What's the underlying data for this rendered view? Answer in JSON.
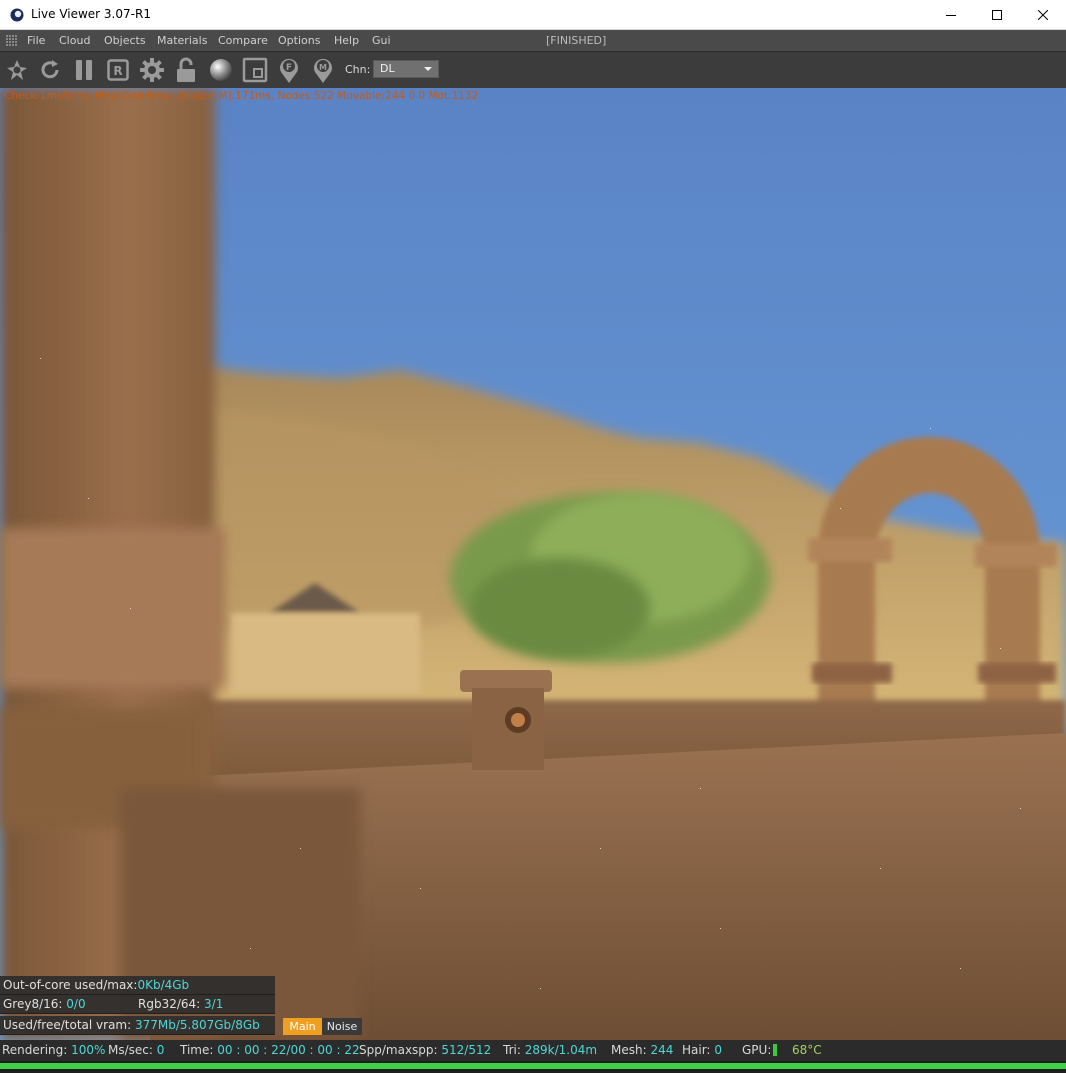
{
  "window": {
    "title": "Live Viewer 3.07-R1"
  },
  "menu": {
    "items": [
      "File",
      "Cloud",
      "Objects",
      "Materials",
      "Compare",
      "Options",
      "Help",
      "Gui"
    ],
    "status": "[FINISHED]"
  },
  "toolbar": {
    "buttons": [
      "scene-icon",
      "refresh-icon",
      "pause-icon",
      "region-icon",
      "settings-icon",
      "lock-icon",
      "material-sphere-icon",
      "focus-frame-icon",
      "focus-pin-icon",
      "material-pin-icon"
    ],
    "channel_label": "Chn:",
    "channel_value": "DL"
  },
  "viewport": {
    "debug_text": "Check:1ms/0ms. MeshGen:0ms. Update[M]:171ms. Nodes:522 Movable:244  0 0 Mot:1132"
  },
  "info": {
    "out_of_core_label": "Out-of-core used/max:",
    "out_of_core_value": "0Kb/4Gb",
    "grey_label": "Grey8/16:",
    "grey_value": "0/0",
    "rgb_label": "Rgb32/64:",
    "rgb_value": "3/1",
    "vram_label": "Used/free/total vram:",
    "vram_value": "377Mb/5.807Gb/8Gb"
  },
  "tabs": {
    "main": "Main",
    "noise": "Noise"
  },
  "status": {
    "rendering_label": "Rendering:",
    "rendering_value": "100%",
    "ms_label": "Ms/sec:",
    "ms_value": "0",
    "time_label": "Time:",
    "time_value": "00 : 00 : 22/00 : 00 : 22",
    "spp_label": "Spp/maxspp:",
    "spp_value": "512/512",
    "tri_label": "Tri:",
    "tri_value": "289k/1.04m",
    "mesh_label": "Mesh:",
    "mesh_value": "244",
    "hair_label": "Hair:",
    "hair_value": "0",
    "gpu_label": "GPU:",
    "gpu_temp": "68°C",
    "progress": 1.0
  },
  "colors": {
    "accent_cyan": "#4fd7d7",
    "tab_active": "#f0a020",
    "progress_green": "#3fd04a",
    "gpu_temp": "#a8d060"
  }
}
